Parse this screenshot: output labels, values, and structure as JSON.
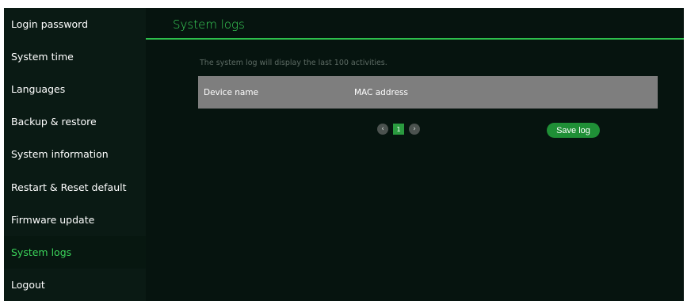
{
  "sidebar": {
    "items": [
      {
        "label": "Login password"
      },
      {
        "label": "System time"
      },
      {
        "label": "Languages"
      },
      {
        "label": "Backup & restore"
      },
      {
        "label": "System information"
      },
      {
        "label": "Restart & Reset default"
      },
      {
        "label": "Firmware update"
      },
      {
        "label": "System logs",
        "active": true
      },
      {
        "label": "Logout"
      }
    ]
  },
  "main": {
    "title": "System logs",
    "description": "The system log will display the last 100 activities.",
    "table": {
      "columns": [
        "Device name",
        "MAC address"
      ]
    },
    "pagination": {
      "prev_icon": "‹",
      "current_page": "1",
      "next_icon": "›"
    },
    "save_label": "Save log"
  },
  "colors": {
    "accent": "#3bd45a",
    "background": "#06140f",
    "sidebar": "#0a1a14",
    "table_header": "#7e7e7e",
    "button": "#1f8f36"
  }
}
